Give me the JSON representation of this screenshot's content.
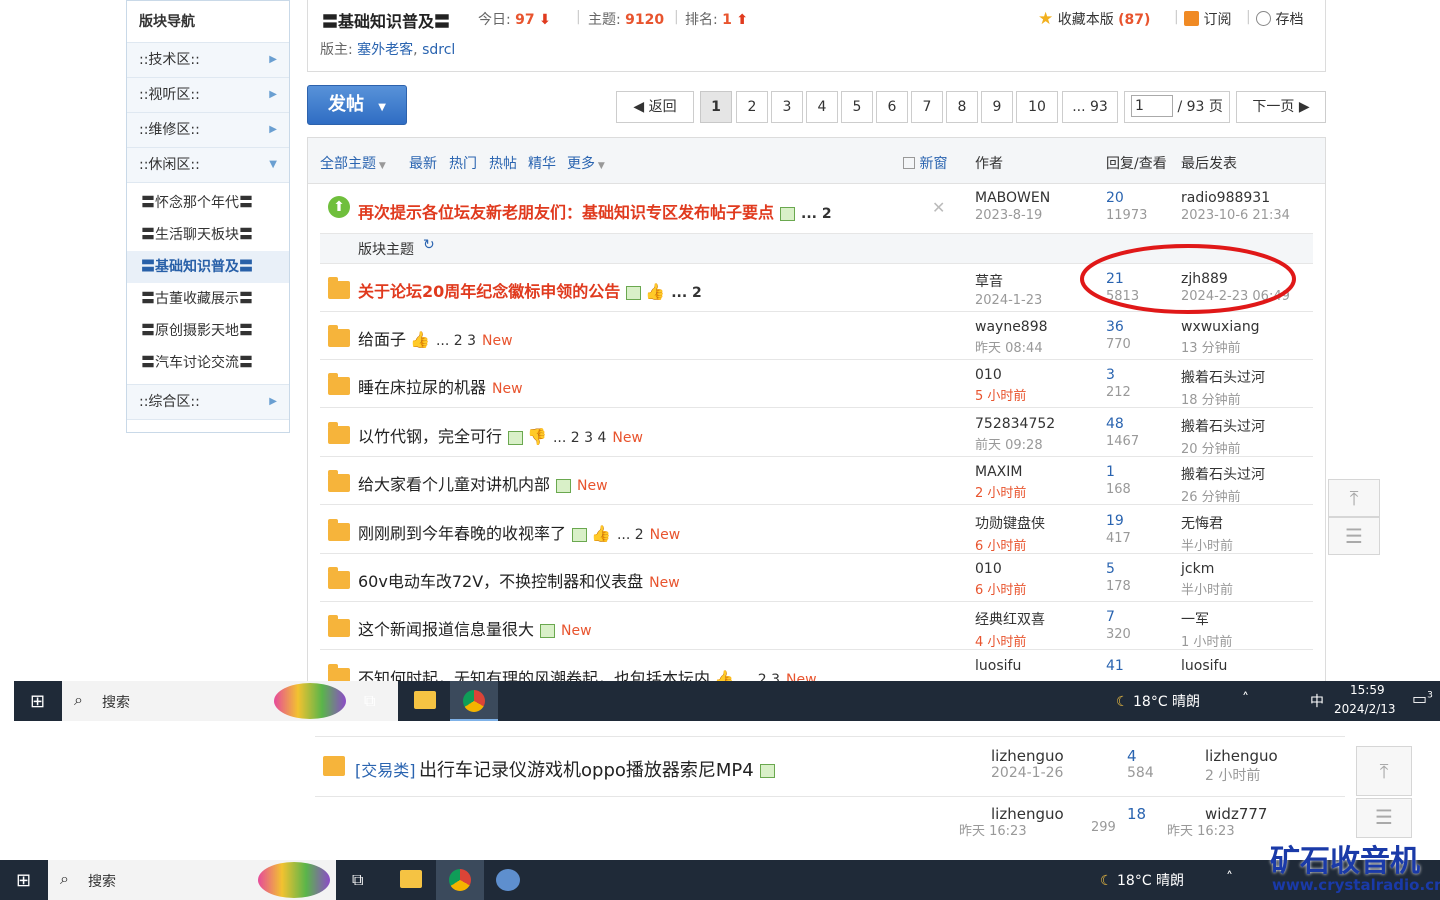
{
  "sidebar": {
    "title": "版块导航",
    "sections": [
      {
        "label": "::技术区::"
      },
      {
        "label": "::视听区::"
      },
      {
        "label": "::维修区::"
      },
      {
        "label": "::休闲区::"
      }
    ],
    "subs": [
      "〓怀念那个年代〓",
      "〓生活聊天板块〓",
      "〓基础知识普及〓",
      "〓古董收藏展示〓",
      "〓原创摄影天地〓",
      "〓汽车讨论交流〓"
    ],
    "last": "::综合区::"
  },
  "forum": {
    "title": "〓基础知识普及〓",
    "today_label": "今日:",
    "today": "97",
    "topics_label": "主题:",
    "topics": "9120",
    "rank_label": "排名:",
    "rank": "1",
    "fav_label": "收藏本版",
    "fav": "(87)",
    "subscribe": "订阅",
    "archive": "存档",
    "mods_label": "版主:",
    "mod1": "塞外老客",
    "mod2": "sdrcl"
  },
  "postbtn": "发帖",
  "pager": {
    "back": "返回",
    "pages": [
      "1",
      "2",
      "3",
      "4",
      "5",
      "6",
      "7",
      "8",
      "9",
      "10",
      "... 93"
    ],
    "input": "1",
    "total": "/ 93 页",
    "next": "下一页"
  },
  "listhead": {
    "all": "全部主题",
    "newest": "最新",
    "hot": "热门",
    "hotpost": "热帖",
    "digest": "精华",
    "more": "更多",
    "newwin": "新窗",
    "author": "作者",
    "reply": "回复/查看",
    "lastpost": "最后发表"
  },
  "sticky": {
    "title": "再次提示各位坛友新老朋友们：基础知识专区发布帖子要点",
    "pages": "... 2",
    "author": "MABOWEN",
    "date": "2023-8-19",
    "replies": "20",
    "views": "11973",
    "last": "radio988931",
    "lasttime": "2023-10-6 21:34"
  },
  "section_topic": "版块主题",
  "rows": [
    {
      "title": "关于论坛20周年纪念徽标申领的公告",
      "pages": "... 2",
      "author": "草音",
      "date": "2024-1-23",
      "replies": "21",
      "views": "5813",
      "last": "zjh889",
      "lasttime": "2024-2-23 06:49"
    },
    {
      "title": "给面子",
      "pages": "... 2  3",
      "new": "New",
      "author": "wayne898",
      "date": "昨天 08:44",
      "replies": "36",
      "views": "770",
      "last": "wxwuxiang",
      "lasttime": "13 分钟前"
    },
    {
      "title": "睡在床拉尿的机器",
      "new": "New",
      "author": "010",
      "date": "5 小时前",
      "replies": "3",
      "views": "212",
      "last": "搬着石头过河",
      "lasttime": "18 分钟前"
    },
    {
      "title": "以竹代钢，完全可行",
      "pages": "... 2  3  4",
      "new": "New",
      "author": "752834752",
      "date": "前天 09:28",
      "replies": "48",
      "views": "1467",
      "last": "搬着石头过河",
      "lasttime": "20 分钟前"
    },
    {
      "title": "给大家看个儿童对讲机内部",
      "new": "New",
      "author": "MAXIM",
      "date": "2 小时前",
      "replies": "1",
      "views": "168",
      "last": "搬着石头过河",
      "lasttime": "26 分钟前"
    },
    {
      "title": "刚刚刷到今年春晚的收视率了",
      "pages": "... 2",
      "new": "New",
      "author": "功勋键盘侠",
      "date": "6 小时前",
      "replies": "19",
      "views": "417",
      "last": "无悔君",
      "lasttime": "半小时前"
    },
    {
      "title": "60v电动车改72V，不换控制器和仪表盘",
      "new": "New",
      "author": "010",
      "date": "6 小时前",
      "replies": "5",
      "views": "178",
      "last": "jckm",
      "lasttime": "半小时前"
    },
    {
      "title": "这个新闻报道信息量很大",
      "new": "New",
      "author": "经典红双喜",
      "date": "4 小时前",
      "replies": "7",
      "views": "320",
      "last": "一军",
      "lasttime": "1 小时前"
    },
    {
      "title": "不知何时起，无知有理的风潮卷起，也包括本坛内",
      "pages": "... 2  3",
      "new": "New",
      "author": "luosifu",
      "date": "",
      "replies": "41",
      "views": "",
      "last": "luosifu",
      "lasttime": ""
    }
  ],
  "taskbar": {
    "search": "搜索",
    "weather": "18°C  晴朗",
    "ime": "中",
    "time": "15:59",
    "date": "2024/2/13",
    "notif": "3"
  },
  "lower": {
    "row1": {
      "tag": "[交易类]",
      "title": "出行车记录仪游戏机oppo播放器索尼MP4",
      "author": "lizhenguo",
      "date": "2024-1-26",
      "replies": "4",
      "views": "584",
      "last": "lizhenguo",
      "lasttime": "2 小时前"
    },
    "row2": {
      "author": "lizhenguo",
      "date": "昨天 16:23",
      "replies": "18",
      "views": "299",
      "last": "widz777",
      "lasttime": "昨天 16:23"
    }
  },
  "watermark": {
    "brand": "矿石收音机",
    "url": "www.crystalradio.cn"
  }
}
